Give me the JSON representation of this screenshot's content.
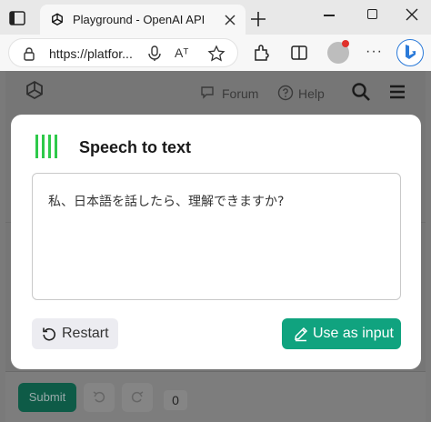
{
  "browser": {
    "tab": {
      "title": "Playground - OpenAI API"
    },
    "url_display": "https://platfor...",
    "read_aloud_glyph": "Aᵀ",
    "more_glyph": "···"
  },
  "header": {
    "forum_label": "Forum",
    "help_label": "Help"
  },
  "modal": {
    "title": "Speech to text",
    "transcript": "私、日本語を話したら、理解できますか?",
    "restart_label": "Restart",
    "use_label": "Use as input",
    "accent_color": "#10a37f",
    "logo_color": "#2ec94a"
  },
  "footer": {
    "submit_label": "Submit",
    "count": "0"
  },
  "icons": [
    "tab-actions-icon",
    "openai-favicon",
    "close-icon",
    "plus-icon",
    "lock-icon",
    "microphone-icon",
    "favorite-star-icon",
    "extensions-icon",
    "split-screen-icon",
    "bing-icon",
    "openai-logo",
    "forum-icon",
    "help-icon",
    "search-icon",
    "menu-icon",
    "restart-icon",
    "pencil-icon",
    "undo-icon",
    "redo-icon"
  ]
}
